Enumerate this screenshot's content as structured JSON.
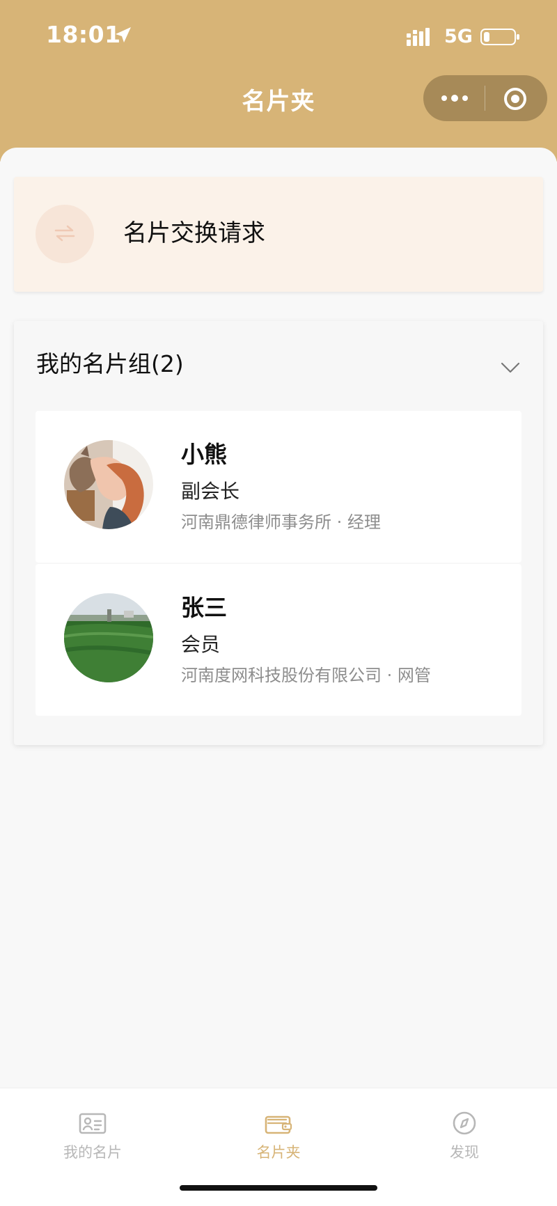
{
  "status_bar": {
    "time": "18:01",
    "network": "5G"
  },
  "header": {
    "title": "名片夹"
  },
  "request_card": {
    "label": "名片交换请求"
  },
  "group": {
    "title": "我的名片组(2)",
    "contacts": [
      {
        "name": "小熊",
        "role": "副会长",
        "company": "河南鼎德律师事务所 · 经理"
      },
      {
        "name": "张三",
        "role": "会员",
        "company": "河南度网科技股份有限公司 · 网管"
      }
    ]
  },
  "tabs": [
    {
      "label": "我的名片",
      "icon": "id-card-icon",
      "color": "#b7b7b7"
    },
    {
      "label": "名片夹",
      "icon": "card-holder-icon",
      "color": "#d7b477"
    },
    {
      "label": "发现",
      "icon": "compass-icon",
      "color": "#b7b7b7"
    }
  ],
  "theme": {
    "accent": "#d7b477",
    "request_bg": "#fbf2e9"
  }
}
